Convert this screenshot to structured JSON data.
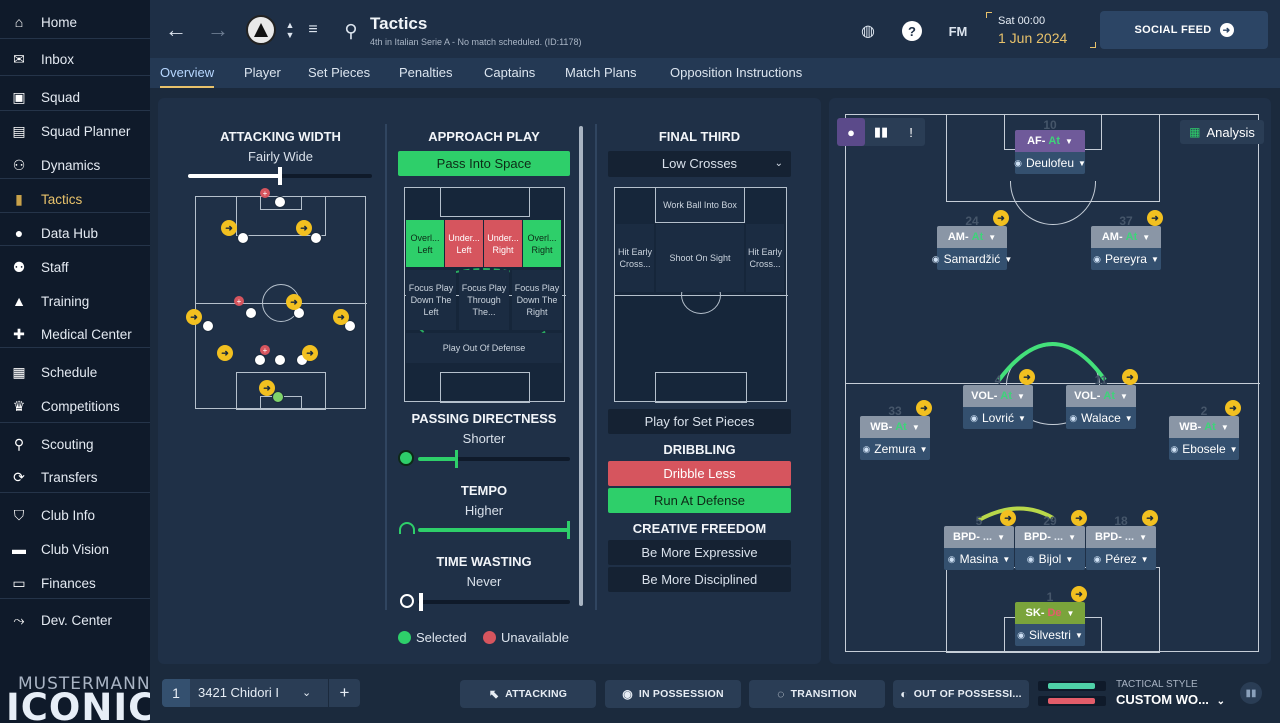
{
  "sidebar": {
    "items": [
      {
        "label": "Home",
        "icon": "home-icon",
        "glyph": "⌂"
      },
      {
        "label": "Inbox",
        "icon": "inbox-icon",
        "glyph": "✉"
      },
      {
        "label": "Squad",
        "icon": "shirt-icon",
        "glyph": "▣"
      },
      {
        "label": "Squad Planner",
        "icon": "clipboard-icon",
        "glyph": "▤"
      },
      {
        "label": "Dynamics",
        "icon": "dynamics-icon",
        "glyph": "⚇"
      },
      {
        "label": "Tactics",
        "icon": "tactics-board-icon",
        "glyph": "▮"
      },
      {
        "label": "Data Hub",
        "icon": "data-hub-icon",
        "glyph": "●"
      },
      {
        "label": "Staff",
        "icon": "staff-icon",
        "glyph": "⚉"
      },
      {
        "label": "Training",
        "icon": "training-cone-icon",
        "glyph": "▲"
      },
      {
        "label": "Medical Center",
        "icon": "medical-kit-icon",
        "glyph": "✚"
      },
      {
        "label": "Schedule",
        "icon": "calendar-icon",
        "glyph": "▦"
      },
      {
        "label": "Competitions",
        "icon": "trophy-icon",
        "glyph": "♛"
      },
      {
        "label": "Scouting",
        "icon": "scouting-search-icon",
        "glyph": "⚲"
      },
      {
        "label": "Transfers",
        "icon": "transfers-icon",
        "glyph": "⟳"
      },
      {
        "label": "Club Info",
        "icon": "club-shield-icon",
        "glyph": "⛉"
      },
      {
        "label": "Club Vision",
        "icon": "briefcase-icon",
        "glyph": "▬"
      },
      {
        "label": "Finances",
        "icon": "finances-icon",
        "glyph": "▭"
      },
      {
        "label": "Dev. Center",
        "icon": "dev-center-icon",
        "glyph": "⤳"
      }
    ],
    "inbox_badge": "",
    "brand_top": "MUSTERMANN",
    "brand_bottom": "ICONIC"
  },
  "header": {
    "title": "Tactics",
    "subtitle": "4th in Italian Serie A - No match scheduled. (ID:1178)",
    "date_day": "Sat 00:00",
    "date_full": "1 Jun 2024",
    "fm_label": "FM",
    "social_label": "SOCIAL FEED"
  },
  "tabs": [
    "Overview",
    "Player",
    "Set Pieces",
    "Penalties",
    "Captains",
    "Match Plans",
    "Opposition Instructions"
  ],
  "attacking_width": {
    "title": "ATTACKING WIDTH",
    "value": "Fairly Wide",
    "level": 0.5
  },
  "approach_play": {
    "title": "APPROACH PLAY",
    "selected": "Pass Into Space",
    "zones": {
      "overlap_left": "Overl... Left",
      "underlap_left": "Under... Left",
      "underlap_right": "Under... Right",
      "overlap_right": "Overl... Right",
      "focus_left": "Focus Play Down The Left",
      "focus_through": "Focus Play Through The...",
      "focus_right": "Focus Play Down The Right",
      "play_out": "Play Out Of Defense"
    }
  },
  "passing_directness": {
    "title": "PASSING DIRECTNESS",
    "value": "Shorter",
    "level": 0.3
  },
  "tempo": {
    "title": "TEMPO",
    "value": "Higher",
    "level": 1.0
  },
  "time_wasting": {
    "title": "TIME WASTING",
    "value": "Never",
    "level": 0.0
  },
  "final_third": {
    "title": "FINAL THIRD",
    "crossing": "Low Crosses",
    "zones": {
      "work_ball": "Work Ball Into Box",
      "hit_early_left": "Hit Early Cross...",
      "shoot_on_sight": "Shoot On Sight",
      "hit_early_right": "Hit Early Cross..."
    },
    "set_pieces": "Play for Set Pieces"
  },
  "dribbling": {
    "title": "DRIBBLING",
    "less": "Dribble Less",
    "run_at": "Run At Defense"
  },
  "creative_freedom": {
    "title": "CREATIVE FREEDOM",
    "expressive": "Be More Expressive",
    "disciplined": "Be More Disciplined"
  },
  "legend": {
    "selected": "Selected",
    "unavailable": "Unavailable"
  },
  "formation_view": {
    "analysis_label": "Analysis"
  },
  "players": [
    {
      "key": "af",
      "role": "AF",
      "duty": "At",
      "name": "Deulofeu",
      "number": "10"
    },
    {
      "key": "am_l",
      "role": "AM",
      "duty": "At",
      "name": "Samardžić",
      "number": "24"
    },
    {
      "key": "am_r",
      "role": "AM",
      "duty": "At",
      "name": "Pereyra",
      "number": "37"
    },
    {
      "key": "vol_l",
      "role": "VOL",
      "duty": "At",
      "name": "Lovrić",
      "number": "4"
    },
    {
      "key": "vol_r",
      "role": "VOL",
      "duty": "At",
      "name": "Walace",
      "number": "11"
    },
    {
      "key": "wb_l",
      "role": "WB",
      "duty": "At",
      "name": "Zemura",
      "number": "33"
    },
    {
      "key": "wb_r",
      "role": "WB",
      "duty": "At",
      "name": "Ebosele",
      "number": "2"
    },
    {
      "key": "bpd_l",
      "role": "BPD",
      "duty": "...",
      "name": "Masina",
      "number": "5"
    },
    {
      "key": "bpd_c",
      "role": "BPD",
      "duty": "...",
      "name": "Bijol",
      "number": "29"
    },
    {
      "key": "bpd_r",
      "role": "BPD",
      "duty": "...",
      "name": "Pérez",
      "number": "18"
    },
    {
      "key": "sk",
      "role": "SK",
      "duty": "De",
      "name": "Silvestri",
      "number": "1"
    }
  ],
  "bottom": {
    "tactic_slot": "1",
    "tactic_name": "3421 Chidori I",
    "add_label": "+",
    "attacking": "ATTACKING",
    "in_possession": "IN POSSESSION",
    "transition": "TRANSITION",
    "out_of_possession": "OUT OF POSSESSI...",
    "style_label": "TACTICAL STYLE",
    "style_value": "CUSTOM WO...",
    "style_bar_pos": 0.9,
    "style_bar_neg": 0.9
  },
  "colors": {
    "accent": "#e8c26b",
    "selected": "#2ecf6a",
    "unavailable": "#d6555e",
    "duty_attack": "#3fd37a"
  }
}
